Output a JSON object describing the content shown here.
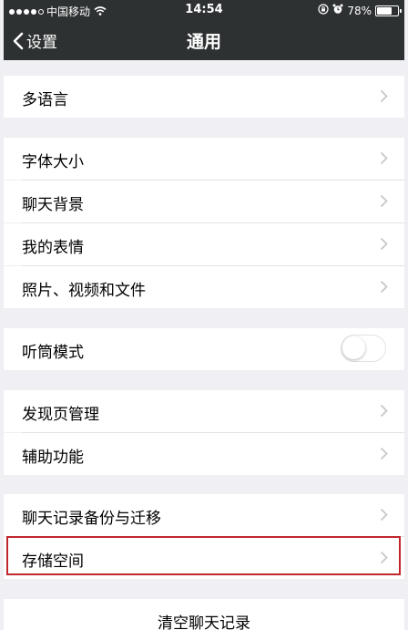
{
  "status_bar": {
    "signal_dots": [
      true,
      true,
      true,
      true,
      false
    ],
    "carrier": "中国移动",
    "time": "14:54",
    "battery_text": "78%",
    "battery_level": 0.78
  },
  "nav": {
    "back_label": "设置",
    "title": "通用"
  },
  "rows": {
    "language": "多语言",
    "font_size": "字体大小",
    "chat_background": "聊天背景",
    "my_stickers": "我的表情",
    "media_files": "照片、视频和文件",
    "earpiece_mode": "听筒模式",
    "discover_manage": "发现页管理",
    "accessibility": "辅助功能",
    "chat_backup": "聊天记录备份与迁移",
    "storage": "存储空间",
    "clear_chat": "清空聊天记录"
  },
  "toggles": {
    "earpiece_mode_on": false
  },
  "colors": {
    "nav_background": "#2e3132",
    "page_background": "#efeff4",
    "highlight_border": "#c0262c"
  }
}
